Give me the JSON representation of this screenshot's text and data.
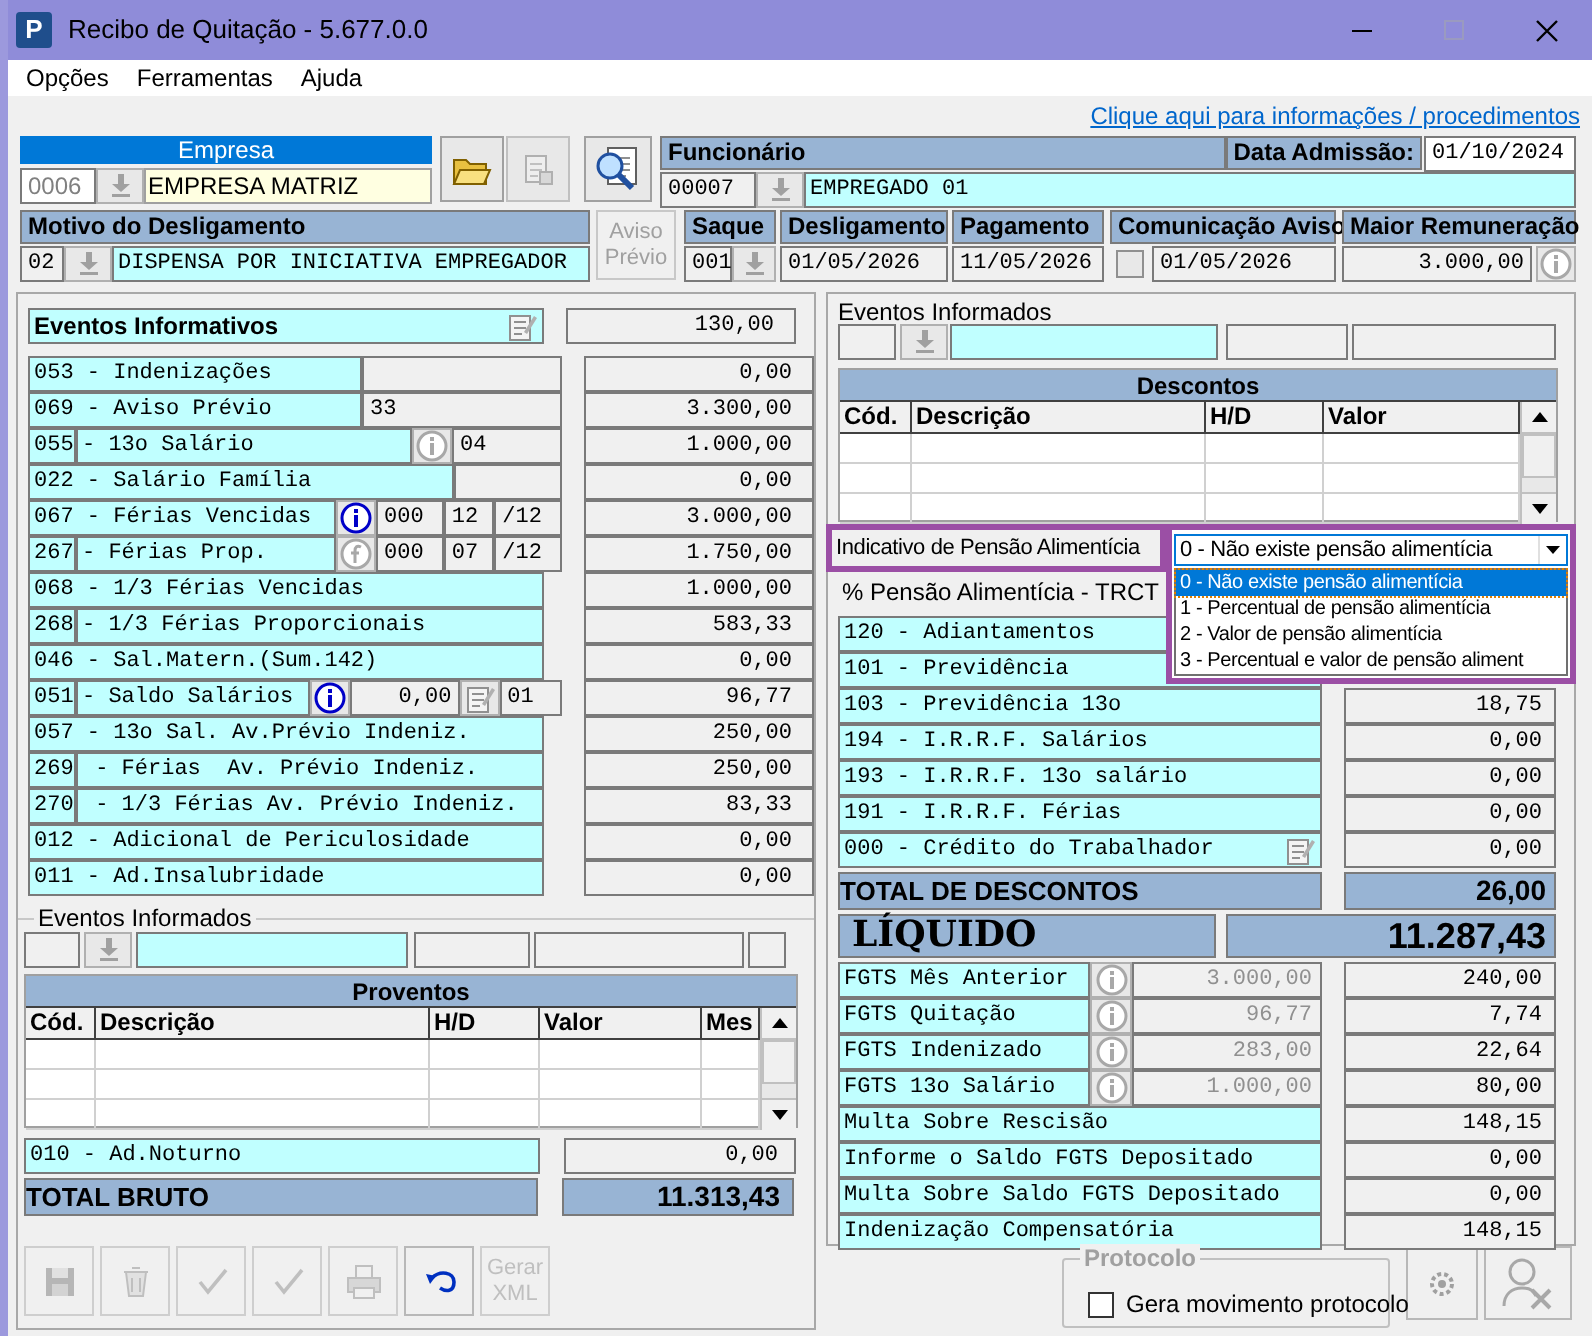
{
  "window": {
    "title": "Recibo de Quitação - 5.677.0.0",
    "icon_letter": "P"
  },
  "menu": [
    "Opções",
    "Ferramentas",
    "Ajuda"
  ],
  "help_link": "Clique aqui para informações / procedimentos",
  "empresa": {
    "label": "Empresa",
    "code": "0006",
    "name": "EMPRESA MATRIZ"
  },
  "funcionario": {
    "label": "Funcionário",
    "code": "00007",
    "name": "EMPREGADO 01",
    "admission_label": "Data Admissão:",
    "admission_date": "01/10/2024"
  },
  "motivo": {
    "label": "Motivo do Desligamento",
    "code": "02",
    "text": "DISPENSA POR INICIATIVA EMPREGADOR"
  },
  "aviso_previo": {
    "label": "Aviso Prévio",
    "disabled": true
  },
  "saque": {
    "label": "Saque",
    "value": "001"
  },
  "desligamento": {
    "label": "Desligamento",
    "value": "01/05/2026"
  },
  "pagamento": {
    "label": "Pagamento",
    "value": "11/05/2026"
  },
  "comunicacao_aviso": {
    "label": "Comunicação Aviso",
    "checked": false,
    "value": "01/05/2026"
  },
  "maior_remuneracao": {
    "label": "Maior Remuneração",
    "value": "3.000,00"
  },
  "eventos_informativos": {
    "title": "Eventos Informativos",
    "total": "130,00",
    "rows": [
      {
        "kind": "plain",
        "text": "053 - Indenizações",
        "value": "0,00",
        "parts": [
          {
            "kind": "field"
          }
        ]
      },
      {
        "kind": "plain",
        "text": "069 - Aviso Prévio",
        "value": "3.300,00",
        "parts": [
          {
            "kind": "field",
            "text": "33"
          }
        ]
      },
      {
        "kind": "split",
        "code": "055",
        "label": "- 13o Salário",
        "value": "1.000,00",
        "parts": [
          {
            "kind": "info",
            "active": false
          },
          {
            "kind": "field",
            "text": "04"
          }
        ]
      },
      {
        "kind": "plain",
        "text": "022 - Salário Família",
        "value": "0,00",
        "parts": [
          {
            "kind": "field"
          }
        ]
      },
      {
        "kind": "plain",
        "text": "067 - Férias Vencidas",
        "value": "3.000,00",
        "parts": [
          {
            "kind": "info",
            "active": true
          },
          {
            "kind": "field",
            "text": "000"
          },
          {
            "kind": "field",
            "text": "12"
          },
          {
            "kind": "field",
            "text": "/12"
          }
        ]
      },
      {
        "kind": "split",
        "code": "267",
        "label": "- Férias Prop.",
        "value": "1.750,00",
        "parts": [
          {
            "kind": "formula"
          },
          {
            "kind": "field",
            "text": "000"
          },
          {
            "kind": "field",
            "text": "07"
          },
          {
            "kind": "field",
            "text": "/12"
          }
        ]
      },
      {
        "kind": "plain",
        "text": "068 - 1/3 Férias Vencidas",
        "value": "1.000,00"
      },
      {
        "kind": "split",
        "code": "268",
        "label": "- 1/3 Férias Proporcionais",
        "value": "583,33"
      },
      {
        "kind": "plain",
        "text": "046 - Sal.Matern.(Sum.142)",
        "value": "0,00"
      },
      {
        "kind": "split",
        "code": "051",
        "label": "- Saldo Salários",
        "value": "96,77",
        "parts": [
          {
            "kind": "info",
            "active": true
          },
          {
            "kind": "field",
            "text": "0,00"
          },
          {
            "kind": "memo"
          },
          {
            "kind": "field",
            "text": "01"
          }
        ]
      },
      {
        "kind": "plain",
        "text": "057 - 13o Sal. Av.Prévio Indeniz.",
        "value": "250,00"
      },
      {
        "kind": "split",
        "code": "269",
        "label": " - Férias  Av. Prévio Indeniz.",
        "value": "250,00"
      },
      {
        "kind": "split",
        "code": "270",
        "label": " - 1/3 Férias Av. Prévio Indeniz.",
        "value": "83,33"
      },
      {
        "kind": "plain",
        "text": "012 - Adicional de Periculosidade",
        "value": "0,00"
      },
      {
        "kind": "plain",
        "text": "011 - Ad.Insalubridade",
        "value": "0,00"
      }
    ]
  },
  "left_eventos_informados": {
    "label": "Eventos Informados"
  },
  "proventos_table": {
    "title": "Proventos",
    "columns": [
      "Cód.",
      "Descrição",
      "H/D",
      "Valor",
      "Mes"
    ]
  },
  "ad_noturno": {
    "text": "010 - Ad.Noturno",
    "value": "0,00"
  },
  "total_bruto": {
    "label": "TOTAL BRUTO",
    "value": "11.313,43"
  },
  "toolbar": [
    {
      "kind": "save",
      "disabled": true
    },
    {
      "kind": "recycle",
      "disabled": true
    },
    {
      "kind": "check",
      "disabled": true
    },
    {
      "kind": "check",
      "disabled": true
    },
    {
      "kind": "print",
      "disabled": true
    },
    {
      "kind": "undo",
      "disabled": false
    },
    {
      "kind": "xml",
      "label": "Gerar XML",
      "disabled": true
    }
  ],
  "right_eventos_informados": {
    "label": "Eventos Informados"
  },
  "descontos_table": {
    "title": "Descontos",
    "columns": [
      "Cód.",
      "Descrição",
      "H/D",
      "Valor"
    ]
  },
  "pensao": {
    "label": "Indicativo de Pensão Alimentícia",
    "highlighted": true,
    "value": "0 - Não existe pensão alimentícia",
    "expanded": true,
    "options": [
      {
        "label": "0 - Não existe pensão alimentícia",
        "selected": true
      },
      {
        "label": "1 - Percentual de pensão alimentícia",
        "selected": false
      },
      {
        "label": "2 - Valor de pensão alimentícia",
        "selected": false
      },
      {
        "label": "3 - Percentual e valor de pensão aliment",
        "selected": false
      }
    ]
  },
  "pensao_trct": {
    "label": "% Pensão Alimentícia - TRCT"
  },
  "descontos": [
    {
      "text": "120 - Adiantamentos"
    },
    {
      "text": "101 - Previdência"
    },
    {
      "text": "103 - Previdência 13o",
      "value": "18,75"
    },
    {
      "text": "194 - I.R.R.F. Salários",
      "value": "0,00"
    },
    {
      "text": "193 - I.R.R.F. 13o salário",
      "value": "0,00"
    },
    {
      "text": "191 - I.R.R.F. Férias",
      "value": "0,00"
    },
    {
      "text": "000 - Crédito do Trabalhador",
      "value": "0,00",
      "memo": true
    }
  ],
  "total_descontos": {
    "label": "TOTAL DE DESCONTOS",
    "value": "26,00"
  },
  "liquido": {
    "label": "LÍQUIDO",
    "value": "11.287,43"
  },
  "fgts": [
    {
      "label": "FGTS Mês Anterior",
      "base": "3.000,00",
      "value": "240,00"
    },
    {
      "label": "FGTS Quitação",
      "base": "96,77",
      "value": "7,74"
    },
    {
      "label": "FGTS Indenizado",
      "base": "283,00",
      "value": "22,64"
    },
    {
      "label": "FGTS 13o Salário",
      "base": "1.000,00",
      "value": "80,00"
    }
  ],
  "multas": [
    {
      "label": "Multa Sobre Rescisão",
      "value": "148,15"
    },
    {
      "label": "Informe o Saldo FGTS Depositado",
      "value": "0,00"
    },
    {
      "label": "Multa Sobre Saldo FGTS Depositado",
      "value": "0,00"
    },
    {
      "label": "Indenização Compensatória",
      "value": "148,15"
    }
  ],
  "protocolo": {
    "title": "Protocolo",
    "checkbox_label": "Gera movimento protocolo",
    "checked": false
  },
  "bottom_buttons": [
    {
      "kind": "gear"
    },
    {
      "kind": "person_search"
    }
  ]
}
